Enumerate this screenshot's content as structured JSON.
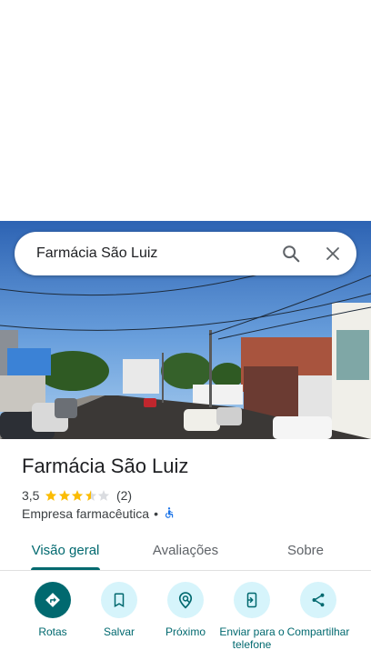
{
  "search": {
    "query": "Farmácia São Luiz"
  },
  "place": {
    "name": "Farmácia São Luiz",
    "rating": "3,5",
    "rating_value": 3.5,
    "reviews_count": "(2)",
    "category": "Empresa farmacêutica",
    "separator": "•"
  },
  "tabs": [
    {
      "label": "Visão geral",
      "active": true
    },
    {
      "label": "Avaliações",
      "active": false
    },
    {
      "label": "Sobre",
      "active": false
    }
  ],
  "actions": [
    {
      "label": "Rotas",
      "icon": "directions-icon"
    },
    {
      "label": "Salvar",
      "icon": "bookmark-icon"
    },
    {
      "label": "Próximo",
      "icon": "nearby-icon"
    },
    {
      "label": "Enviar para o telefone",
      "icon": "send-to-phone-icon"
    },
    {
      "label": "Compartilhar",
      "icon": "share-icon"
    }
  ],
  "colors": {
    "accent": "#01696f",
    "action_bg": "#d6f4fb",
    "star": "#fbbc04",
    "star_empty": "#dadce0",
    "accessibility": "#1a73e8"
  }
}
